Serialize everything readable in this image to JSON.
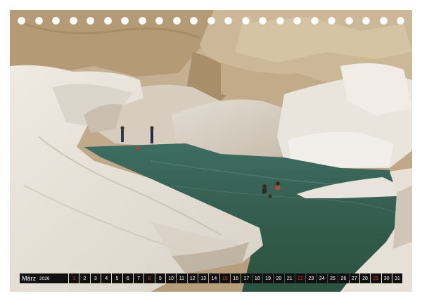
{
  "calendar": {
    "month": "März",
    "year": "2026",
    "days": [
      "1",
      "2",
      "3",
      "4",
      "5",
      "6",
      "7",
      "8",
      "9",
      "10",
      "11",
      "12",
      "13",
      "14",
      "15",
      "16",
      "17",
      "18",
      "19",
      "20",
      "21",
      "22",
      "23",
      "24",
      "25",
      "26",
      "27",
      "28",
      "29",
      "30",
      "31"
    ],
    "sundays": [
      "1",
      "8",
      "15",
      "22",
      "29"
    ],
    "day_color": "#ffffff",
    "sunday_color": "#e0332c",
    "bar_color": "#111111"
  },
  "binding": {
    "hole_count": 23
  }
}
